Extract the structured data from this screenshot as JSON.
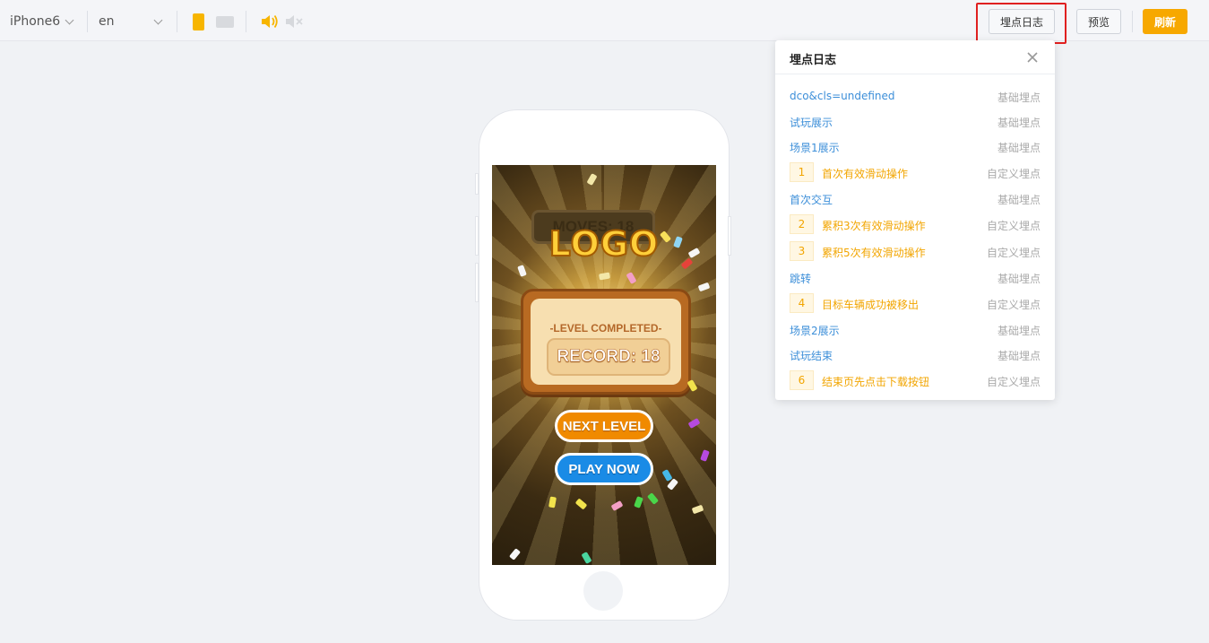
{
  "toolbar": {
    "device": "iPhone6",
    "language": "en",
    "log_button": "埋点日志",
    "preview_button": "预览",
    "refresh_button": "刷新",
    "accent_color": "#f7a800"
  },
  "game": {
    "moves_label": "MOVES: 18",
    "logo_text": "LOGO",
    "level_completed": "-LEVEL COMPLETED-",
    "record_label": "RECORD: 18",
    "next_level_button": "NEXT LEVEL",
    "play_now_button": "PLAY NOW"
  },
  "log_panel": {
    "title": "埋点日志",
    "items": [
      {
        "name": "dco&cls=undefined",
        "type": "基础埋点",
        "index": ""
      },
      {
        "name": "试玩展示",
        "type": "基础埋点",
        "index": ""
      },
      {
        "name": "场景1展示",
        "type": "基础埋点",
        "index": ""
      },
      {
        "name": "首次有效滑动操作",
        "type": "自定义埋点",
        "index": "1"
      },
      {
        "name": "首次交互",
        "type": "基础埋点",
        "index": ""
      },
      {
        "name": "累积3次有效滑动操作",
        "type": "自定义埋点",
        "index": "2"
      },
      {
        "name": "累积5次有效滑动操作",
        "type": "自定义埋点",
        "index": "3"
      },
      {
        "name": "跳转",
        "type": "基础埋点",
        "index": ""
      },
      {
        "name": "目标车辆成功被移出",
        "type": "自定义埋点",
        "index": "4"
      },
      {
        "name": "场景2展示",
        "type": "基础埋点",
        "index": ""
      },
      {
        "name": "试玩结束",
        "type": "基础埋点",
        "index": ""
      },
      {
        "name": "结束页先点击下载按钮",
        "type": "自定义埋点",
        "index": "6"
      }
    ]
  }
}
